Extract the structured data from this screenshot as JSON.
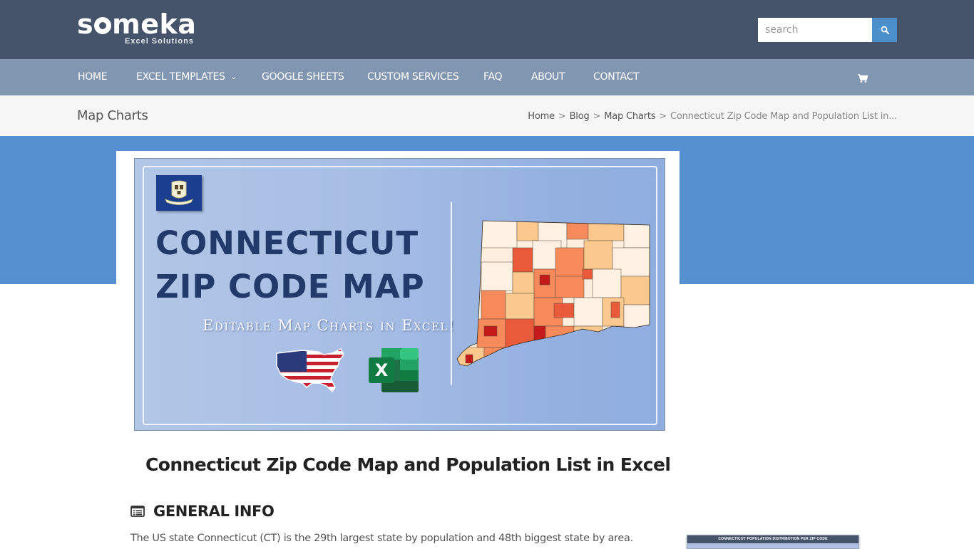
{
  "header": {
    "logo_text": "someka",
    "logo_subtitle": "Excel Solutions",
    "search": {
      "placeholder": "search",
      "value": ""
    },
    "search_icon": "search-icon"
  },
  "nav": {
    "items": [
      {
        "label": "HOME"
      },
      {
        "label": "EXCEL TEMPLATES",
        "has_dropdown": true
      },
      {
        "label": "GOOGLE SHEETS"
      },
      {
        "label": "CUSTOM SERVICES"
      },
      {
        "label": "FAQ"
      },
      {
        "label": "ABOUT"
      },
      {
        "label": "CONTACT"
      }
    ],
    "cart_icon": "shopping-cart-icon"
  },
  "titlebar": {
    "section": "Map Charts",
    "breadcrumb": [
      {
        "label": "Home"
      },
      {
        "label": "Blog"
      },
      {
        "label": "Map Charts"
      },
      {
        "label": "Connecticut Zip Code Map and Population List in..."
      }
    ],
    "separator": ">"
  },
  "hero": {
    "title_line1": "CONNECTICUT",
    "title_line2": "ZIP CODE MAP",
    "subtitle": "Editable Map Charts in Excel!",
    "excel_letter": "X"
  },
  "article": {
    "title": "Connecticut Zip Code Map and Population List in Excel",
    "section_title": "GENERAL INFO",
    "body": "The US state Connecticut (CT) is the 29th largest state by population and 48th biggest state by area."
  },
  "sidebar": {
    "thumb_title": "CONNECTICUT POPULATION DISTRIBUTION PER ZIP CODE"
  },
  "colors": {
    "header_bg": "#45536b",
    "nav_bg": "#8196b0",
    "accent_blue": "#5790d0",
    "search_btn": "#4a8fc9",
    "title_navy": "#213a6a"
  }
}
